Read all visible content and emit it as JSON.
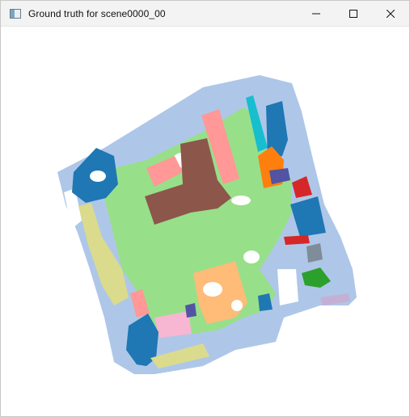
{
  "window": {
    "title": "Ground truth for scene0000_00",
    "app_icon": "window-app-icon",
    "controls": {
      "minimize_icon": "minimize-icon",
      "maximize_icon": "maximize-icon",
      "close_icon": "close-icon"
    }
  },
  "visualization": {
    "description_icon": "semantic-segmentation-render",
    "colors": {
      "wall": "#aec7e8",
      "floor": "#98df8a",
      "cabinet": "#1f77b4",
      "bed": "#ff9896",
      "table": "#8c564b",
      "door": "#dbdb8d",
      "chair": "#ffbb78",
      "sofa": "#f7b6d2",
      "cyan_object": "#17becf",
      "orange_object": "#ff7f0e",
      "purple_object": "#5254a3",
      "red_object": "#d62728",
      "green_object": "#2ca02c",
      "gray_object": "#7f8c99",
      "lilac_object": "#c5b0d5"
    }
  }
}
